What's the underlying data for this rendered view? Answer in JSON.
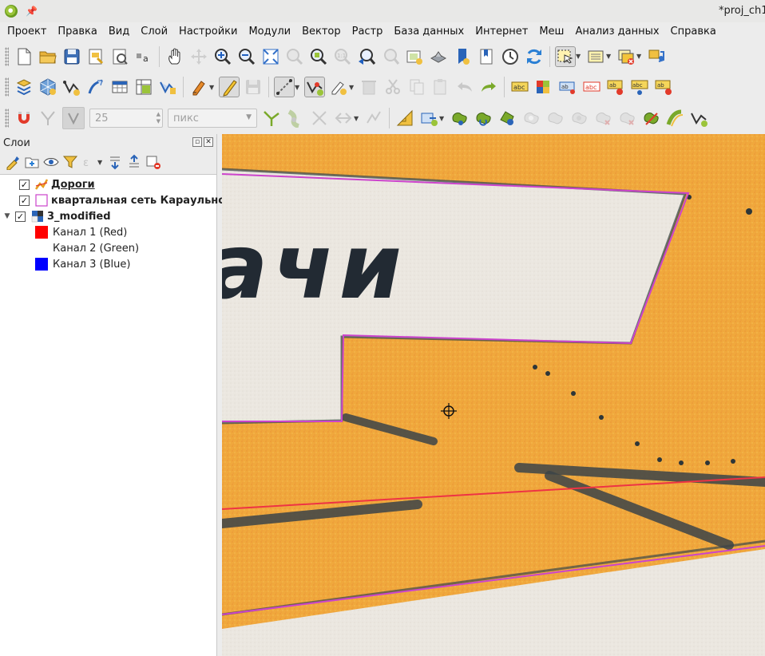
{
  "window": {
    "title": "*proj_ch1"
  },
  "menu": [
    "Проект",
    "Правка",
    "Вид",
    "Слой",
    "Настройки",
    "Модули",
    "Вектор",
    "Растр",
    "База данных",
    "Интернет",
    "Меш",
    "Анализ данных",
    "Справка"
  ],
  "snapping": {
    "tolerance_value": "25",
    "units_value": "пикс"
  },
  "layers_panel": {
    "title": "Слои",
    "layers": [
      {
        "name": "Дороги",
        "checked": "✓",
        "icon": "line-layer-icon"
      },
      {
        "name": "квартальная сеть Караульное",
        "checked": "✓",
        "icon": "polygon-layer-icon"
      },
      {
        "name": "3_modified",
        "checked": "✓",
        "icon": "raster-layer-icon"
      }
    ],
    "bands": [
      {
        "name": "Канал 1 (Red)",
        "color": "#ff0000"
      },
      {
        "name": "Канал 2 (Green)",
        "color": "#ffffff"
      },
      {
        "name": "Канал 3 (Blue)",
        "color": "#0000ff"
      }
    ]
  },
  "map": {
    "visible_text": "ачи",
    "colors": {
      "land": "#f0a83c",
      "block_outline": "#cc44cc",
      "road_line": "#ee3344"
    }
  },
  "colors": {
    "accent": "#3c7fd4",
    "qgis_green": "#8cbb2f"
  }
}
